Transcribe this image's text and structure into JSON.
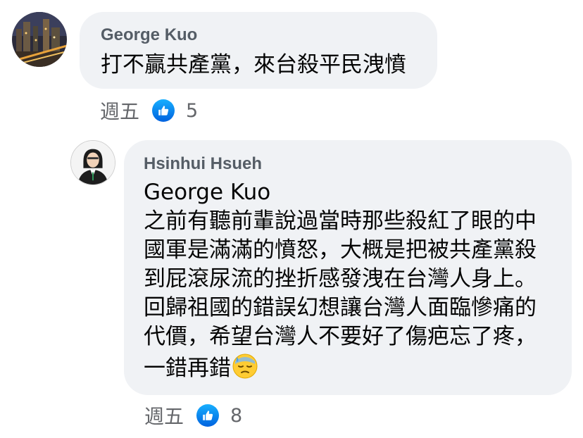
{
  "comments": [
    {
      "author": "George Kuo",
      "lines": [
        "打不贏共產黨，來台殺平民洩憤"
      ],
      "time": "週五",
      "reactions": "5",
      "reaction_icon": "like-icon"
    },
    {
      "author": "Hsinhui Hsueh",
      "mention": "George Kuo",
      "lines": [
        "之前有聽前輩說過當時那些殺紅了眼的中",
        "國軍是滿滿的憤怒，大概是把被共產黨殺",
        "到屁滾尿流的挫折感發洩在台灣人身上。",
        "回歸祖國的錯誤幻想讓台灣人面臨慘痛的",
        "代價，希望台灣人不要好了傷疤忘了疼，",
        "一錯再錯"
      ],
      "emoji": "downcast-face-with-sweat-emoji",
      "time": "週五",
      "reactions": "8",
      "reaction_icon": "like-icon"
    }
  ],
  "colors": {
    "bubble": "#f0f2f5",
    "author": "#555d66",
    "meta": "#65676b",
    "like_blue": "#1877f2"
  }
}
